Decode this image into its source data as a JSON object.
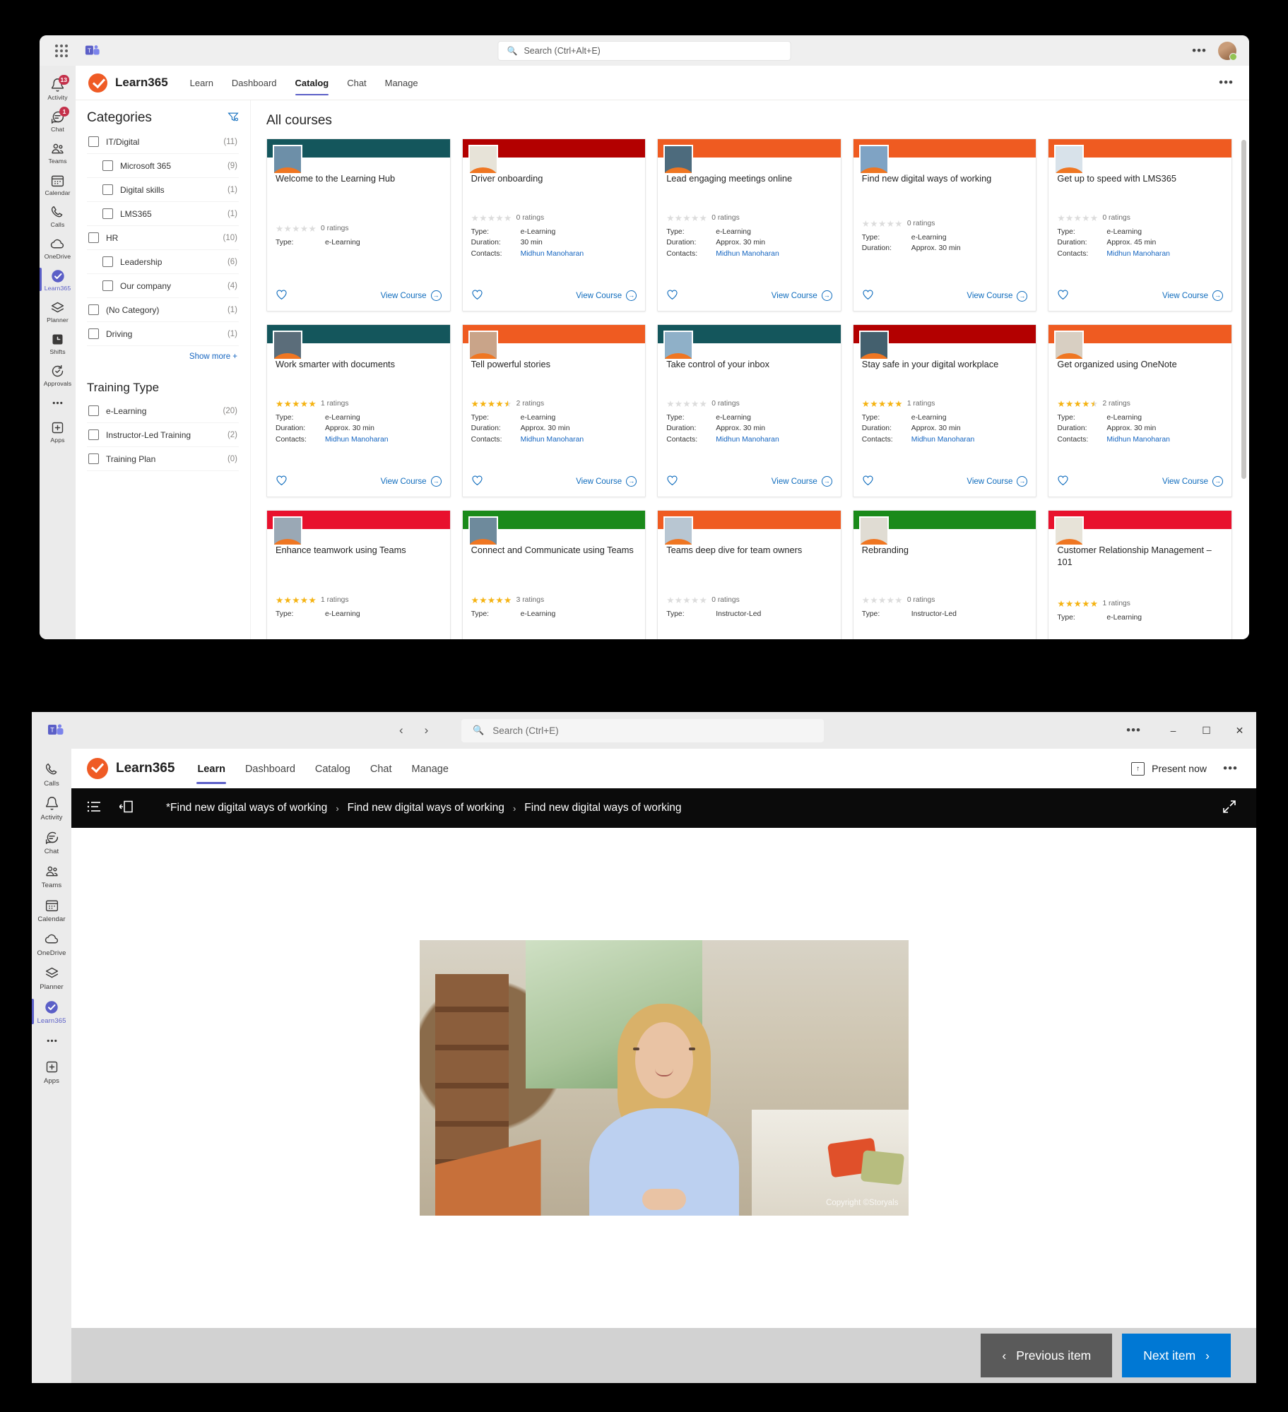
{
  "top_window": {
    "titlebar": {
      "waffle_icon": "app-launcher-icon",
      "teams_icon": "teams-logo-icon",
      "search_placeholder": "Search (Ctrl+Alt+E)",
      "more_label": "•••",
      "avatar_label": "user-avatar"
    },
    "rail": [
      {
        "label": "Activity",
        "icon": "bell-icon",
        "badge": "13",
        "active": false
      },
      {
        "label": "Chat",
        "icon": "chat-icon",
        "badge": "1",
        "active": false
      },
      {
        "label": "Teams",
        "icon": "teams-people-icon",
        "badge": "",
        "active": false
      },
      {
        "label": "Calendar",
        "icon": "calendar-icon",
        "badge": "",
        "active": false
      },
      {
        "label": "Calls",
        "icon": "phone-icon",
        "badge": "",
        "active": false
      },
      {
        "label": "OneDrive",
        "icon": "cloud-icon",
        "badge": "",
        "active": false
      },
      {
        "label": "Learn365",
        "icon": "learn365-check-icon",
        "badge": "",
        "active": true
      },
      {
        "label": "Planner",
        "icon": "planner-icon",
        "badge": "",
        "active": false
      },
      {
        "label": "Shifts",
        "icon": "shifts-icon",
        "badge": "",
        "active": false
      },
      {
        "label": "Approvals",
        "icon": "approvals-icon",
        "badge": "",
        "active": false
      },
      {
        "label": "",
        "icon": "more-dots-icon",
        "badge": "",
        "active": false
      },
      {
        "label": "Apps",
        "icon": "apps-plus-icon",
        "badge": "",
        "active": false
      }
    ],
    "app": {
      "brand": "Learn365",
      "nav": [
        {
          "label": "Learn",
          "selected": false
        },
        {
          "label": "Dashboard",
          "selected": false
        },
        {
          "label": "Catalog",
          "selected": true
        },
        {
          "label": "Chat",
          "selected": false
        },
        {
          "label": "Manage",
          "selected": false
        }
      ],
      "overflow": "•••"
    },
    "facets": {
      "categories_title": "Categories",
      "filter_icon": "filter-icon",
      "categories": [
        {
          "label": "IT/Digital",
          "count": "(11)",
          "sub": false
        },
        {
          "label": "Microsoft 365",
          "count": "(9)",
          "sub": true
        },
        {
          "label": "Digital skills",
          "count": "(1)",
          "sub": true
        },
        {
          "label": "LMS365",
          "count": "(1)",
          "sub": true
        },
        {
          "label": "HR",
          "count": "(10)",
          "sub": false
        },
        {
          "label": "Leadership",
          "count": "(6)",
          "sub": true
        },
        {
          "label": "Our company",
          "count": "(4)",
          "sub": true
        },
        {
          "label": "(No Category)",
          "count": "(1)",
          "sub": false
        },
        {
          "label": "Driving",
          "count": "(1)",
          "sub": false
        }
      ],
      "show_more": "Show more +",
      "training_type_title": "Training Type",
      "training_types": [
        {
          "label": "e-Learning",
          "count": "(20)"
        },
        {
          "label": "Instructor-Led Training",
          "count": "(2)"
        },
        {
          "label": "Training Plan",
          "count": "(0)"
        }
      ]
    },
    "catalog": {
      "title": "All courses",
      "labels": {
        "type": "Type:",
        "duration": "Duration:",
        "contacts": "Contacts:",
        "view_course": "View Course",
        "favorite_icon": "heart-icon",
        "arrow_icon": "arrow-right-circle-icon"
      },
      "cards": [
        {
          "title": "Welcome to the Learning Hub",
          "band": "#14565c",
          "stars": 0,
          "ratings": "0 ratings",
          "type": "e-Learning",
          "duration": "",
          "contacts": ""
        },
        {
          "title": "Driver onboarding",
          "band": "#b30000",
          "stars": 0,
          "ratings": "0 ratings",
          "type": "e-Learning",
          "duration": "30 min",
          "contacts": "Midhun Manoharan"
        },
        {
          "title": "Lead engaging meetings online",
          "band": "#ef5b21",
          "stars": 0,
          "ratings": "0 ratings",
          "type": "e-Learning",
          "duration": "Approx. 30 min",
          "contacts": "Midhun Manoharan"
        },
        {
          "title": "Find new digital ways of working",
          "band": "#ef5b21",
          "stars": 0,
          "ratings": "0 ratings",
          "type": "e-Learning",
          "duration": "Approx. 30 min",
          "contacts": ""
        },
        {
          "title": "Get up to speed with LMS365",
          "band": "#ef5b21",
          "stars": 0,
          "ratings": "0 ratings",
          "type": "e-Learning",
          "duration": "Approx. 45 min",
          "contacts": "Midhun Manoharan"
        },
        {
          "title": "Work smarter with documents",
          "band": "#14565c",
          "stars": 5,
          "ratings": "1 ratings",
          "type": "e-Learning",
          "duration": "Approx. 30 min",
          "contacts": "Midhun Manoharan"
        },
        {
          "title": "Tell powerful stories",
          "band": "#ef5b21",
          "stars": 4.5,
          "ratings": "2 ratings",
          "type": "e-Learning",
          "duration": "Approx. 30 min",
          "contacts": "Midhun Manoharan"
        },
        {
          "title": "Take control of your inbox",
          "band": "#14565c",
          "stars": 0,
          "ratings": "0 ratings",
          "type": "e-Learning",
          "duration": "Approx. 30 min",
          "contacts": "Midhun Manoharan"
        },
        {
          "title": "Stay safe in your digital workplace",
          "band": "#b30000",
          "stars": 5,
          "ratings": "1 ratings",
          "type": "e-Learning",
          "duration": "Approx. 30 min",
          "contacts": "Midhun Manoharan"
        },
        {
          "title": "Get organized using OneNote",
          "band": "#ef5b21",
          "stars": 4.5,
          "ratings": "2 ratings",
          "type": "e-Learning",
          "duration": "Approx. 30 min",
          "contacts": "Midhun Manoharan"
        },
        {
          "title": "Enhance teamwork using Teams",
          "band": "#e8112d",
          "stars": 5,
          "ratings": "1 ratings",
          "type": "e-Learning",
          "duration": "",
          "contacts": ""
        },
        {
          "title": "Connect and Communicate using Teams",
          "band": "#1a8a1a",
          "stars": 5,
          "ratings": "3 ratings",
          "type": "e-Learning",
          "duration": "",
          "contacts": ""
        },
        {
          "title": "Teams deep dive for team owners",
          "band": "#ef5b21",
          "stars": 0,
          "ratings": "0 ratings",
          "type": "Instructor-Led",
          "duration": "",
          "contacts": ""
        },
        {
          "title": "Rebranding",
          "band": "#1a8a1a",
          "stars": 0,
          "ratings": "0 ratings",
          "type": "Instructor-Led",
          "duration": "",
          "contacts": ""
        },
        {
          "title": "Customer Relationship Management – 101",
          "band": "#e8112d",
          "stars": 5,
          "ratings": "1 ratings",
          "type": "e-Learning",
          "duration": "",
          "contacts": ""
        }
      ]
    }
  },
  "bottom_window": {
    "titlebar": {
      "teams_icon": "teams-logo-icon",
      "back_icon": "chevron-left-icon",
      "forward_icon": "chevron-right-icon",
      "search_placeholder": "Search (Ctrl+E)",
      "more_label": "•••",
      "minimize": "–",
      "maximize": "☐",
      "close": "✕"
    },
    "rail": [
      {
        "label": "Calls",
        "icon": "phone-icon",
        "active": false
      },
      {
        "label": "Activity",
        "icon": "bell-icon",
        "active": false
      },
      {
        "label": "Chat",
        "icon": "chat-icon",
        "active": false
      },
      {
        "label": "Teams",
        "icon": "teams-people-icon",
        "active": false
      },
      {
        "label": "Calendar",
        "icon": "calendar-icon",
        "active": false
      },
      {
        "label": "OneDrive",
        "icon": "cloud-icon",
        "active": false
      },
      {
        "label": "Planner",
        "icon": "planner-icon",
        "active": false
      },
      {
        "label": "Learn365",
        "icon": "learn365-check-icon",
        "active": true
      },
      {
        "label": "",
        "icon": "more-dots-icon",
        "active": false
      },
      {
        "label": "Apps",
        "icon": "apps-plus-icon",
        "active": false
      }
    ],
    "app": {
      "brand": "Learn365",
      "nav": [
        {
          "label": "Learn",
          "selected": true
        },
        {
          "label": "Dashboard",
          "selected": false
        },
        {
          "label": "Catalog",
          "selected": false
        },
        {
          "label": "Chat",
          "selected": false
        },
        {
          "label": "Manage",
          "selected": false
        }
      ],
      "present_now": "Present now",
      "present_icon": "present-now-icon",
      "overflow": "•••"
    },
    "breadcrumb": {
      "menu_icon": "outline-list-icon",
      "panel_icon": "collapse-panel-icon",
      "expand_icon": "fullscreen-icon",
      "separator": "›",
      "items": [
        "*Find new digital ways of working",
        "Find new digital ways of working",
        "Find new digital ways of working"
      ]
    },
    "stage": {
      "media_name": "course-video-frame",
      "copyright": "Copyright ©Storyals"
    },
    "footer": {
      "previous": "Previous item",
      "next": "Next item",
      "prev_icon": "chevron-left-icon",
      "next_icon": "chevron-right-icon",
      "prev_color": "#5a5a5a",
      "next_color": "#0078d4"
    }
  }
}
